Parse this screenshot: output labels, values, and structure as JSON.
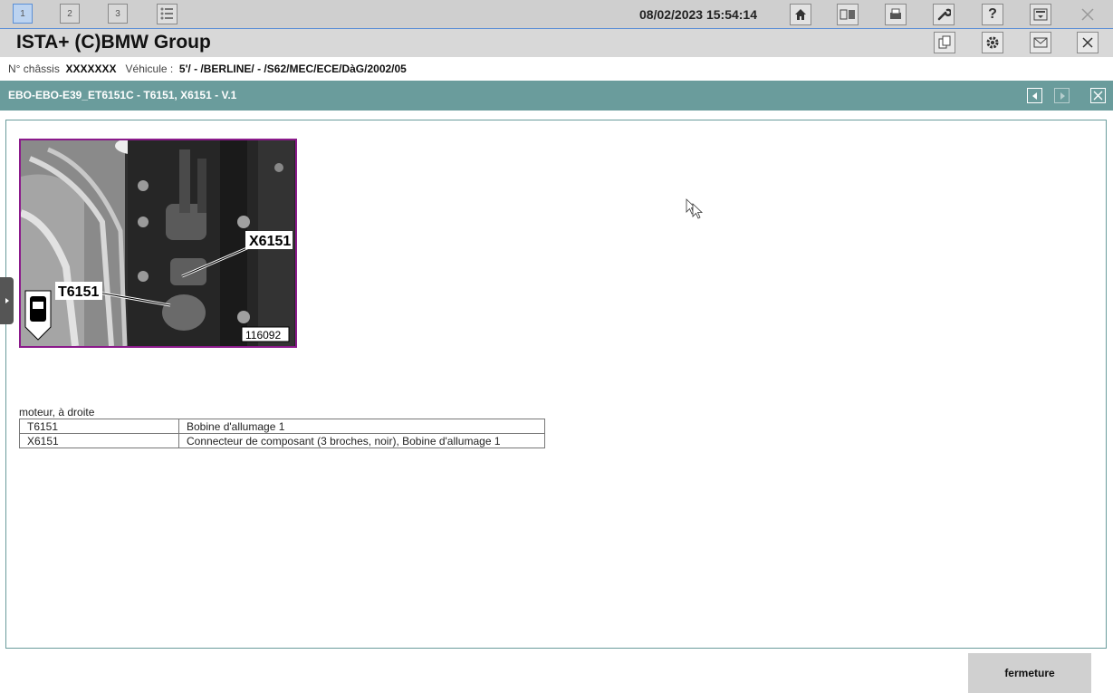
{
  "toolbar": {
    "tabs": [
      "1",
      "2",
      "3"
    ],
    "datetime": "08/02/2023 15:54:14"
  },
  "titlebar": {
    "title": "ISTA+ (C)BMW Group"
  },
  "vehicle": {
    "chassis_label": "N° châssis",
    "chassis_value": "XXXXXXX",
    "vehicle_label": "Véhicule :",
    "vehicle_value": "5'/ - /BERLINE/ - /S62/MEC/ECE/DàG/2002/05"
  },
  "document": {
    "title": "EBO-EBO-E39_ET6151C - T6151, X6151 - V.1"
  },
  "figure": {
    "label_x": "X6151",
    "label_t": "T6151",
    "image_number": "116092"
  },
  "parts": {
    "caption": "moteur, à droite",
    "rows": [
      {
        "code": "T6151",
        "description": "Bobine d'allumage 1"
      },
      {
        "code": "X6151",
        "description": "Connecteur de composant (3 broches, noir), Bobine d'allumage 1"
      }
    ]
  },
  "footer": {
    "close_label": "fermeture"
  },
  "colors": {
    "doc_header": "#6a9c9c",
    "figure_border": "#8b1a8b",
    "active_tab": "#bcd3f0"
  }
}
